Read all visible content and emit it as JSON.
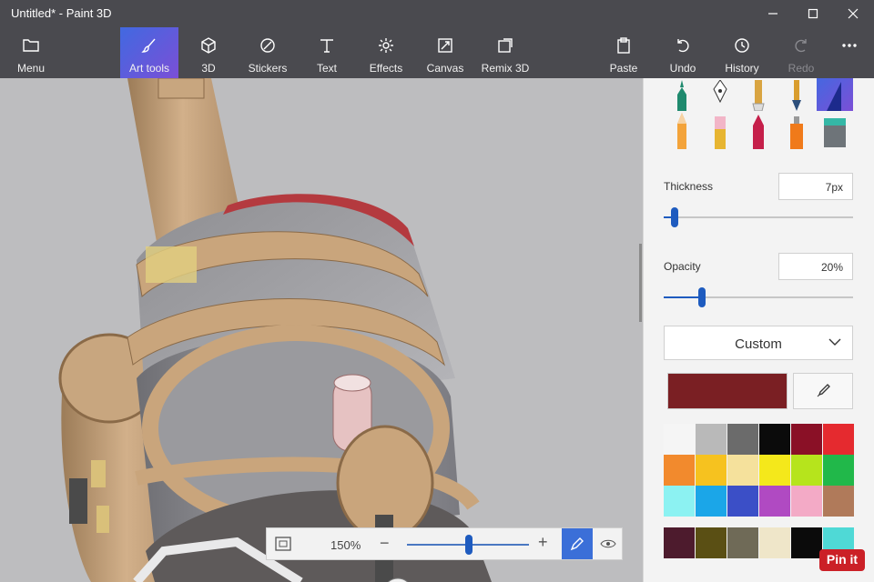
{
  "window": {
    "title": "Untitled* - Paint 3D"
  },
  "toolbar": {
    "menu": "Menu",
    "art_tools": "Art tools",
    "three_d": "3D",
    "stickers": "Stickers",
    "text": "Text",
    "effects": "Effects",
    "canvas": "Canvas",
    "remix": "Remix 3D",
    "paste": "Paste",
    "undo": "Undo",
    "history": "History",
    "redo": "Redo"
  },
  "panel": {
    "thickness_label": "Thickness",
    "thickness_value": "7px",
    "thickness_level": 0.06,
    "opacity_label": "Opacity",
    "opacity_value": "20%",
    "opacity_level": 0.2,
    "finish_dropdown": "Custom",
    "current_color": "#7a1f23",
    "swatches_row1": [
      "#f5f5f5",
      "#b9b9b9",
      "#6b6b6b",
      "#0b0b0b",
      "#8a1026",
      "#e52a2f"
    ],
    "swatches_row2": [
      "#f28a2d",
      "#f6c21f",
      "#f5e19c",
      "#f4e81b",
      "#b6e41c",
      "#21b84a"
    ],
    "swatches_row3": [
      "#8cf2f2",
      "#1ba6e8",
      "#3b4fc7",
      "#b04ac2",
      "#f3aac6",
      "#b07a5a"
    ],
    "swatches_row4": [
      "#4d1b2d",
      "#5a4f14",
      "#6f6a57",
      "#efe6c9",
      "#0b0b0b",
      "#4fd9d6"
    ]
  },
  "zoom": {
    "value": "150%",
    "level": 0.5
  },
  "watermark": "Pin it"
}
